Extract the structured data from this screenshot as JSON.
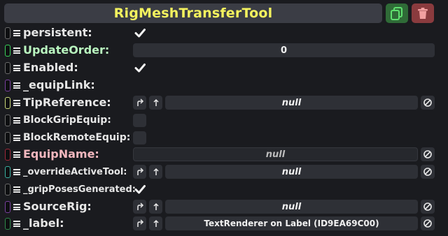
{
  "header": {
    "title": "RigMeshTransferTool",
    "duplicate_icon": "duplicate-icon",
    "delete_icon": "trash-icon",
    "colors": {
      "title": "#f4f35e",
      "duplicate_bg": "#2f6b37",
      "delete_bg": "#8a3b3e"
    }
  },
  "fields": [
    {
      "label": "persistent:",
      "type": "checkbox",
      "checked": true,
      "pill_color": "#6a6a6a"
    },
    {
      "label": "UpdateOrder:",
      "type": "number",
      "value": "0",
      "pill_color": "#3ad15a",
      "label_color": "#b9f5bf"
    },
    {
      "label": "Enabled:",
      "type": "checkbox",
      "checked": true,
      "pill_color": "#6a6a6a"
    },
    {
      "label": "_equipLink:",
      "type": "none",
      "pill_color": "#7a3fa0"
    },
    {
      "label": "TipReference:",
      "type": "reference",
      "value": "null",
      "pill_color": "#cbd97a"
    },
    {
      "label": "BlockGripEquip:",
      "type": "checkbox",
      "checked": false,
      "pill_color": "#6a6a6a"
    },
    {
      "label": "BlockRemoteEquip:",
      "type": "checkbox",
      "checked": false,
      "pill_color": "#6a6a6a"
    },
    {
      "label": "EquipName:",
      "type": "text",
      "value": "null",
      "pill_color": "#a0283a",
      "label_color": "#f2b7be"
    },
    {
      "label": "_overrideActiveTool:",
      "type": "reference",
      "value": "null",
      "pill_color": "#3ab0a0"
    },
    {
      "label": "_gripPosesGenerated:",
      "type": "checkbox",
      "checked": true,
      "pill_color": "#6a6a6a"
    },
    {
      "label": "SourceRig:",
      "type": "reference",
      "value": "null",
      "pill_color": "#7a3fa0"
    },
    {
      "label": "_label:",
      "type": "reference",
      "value": "TextRenderer on Label (ID9EA69C00)",
      "pill_color": "#2f8a4a"
    }
  ]
}
